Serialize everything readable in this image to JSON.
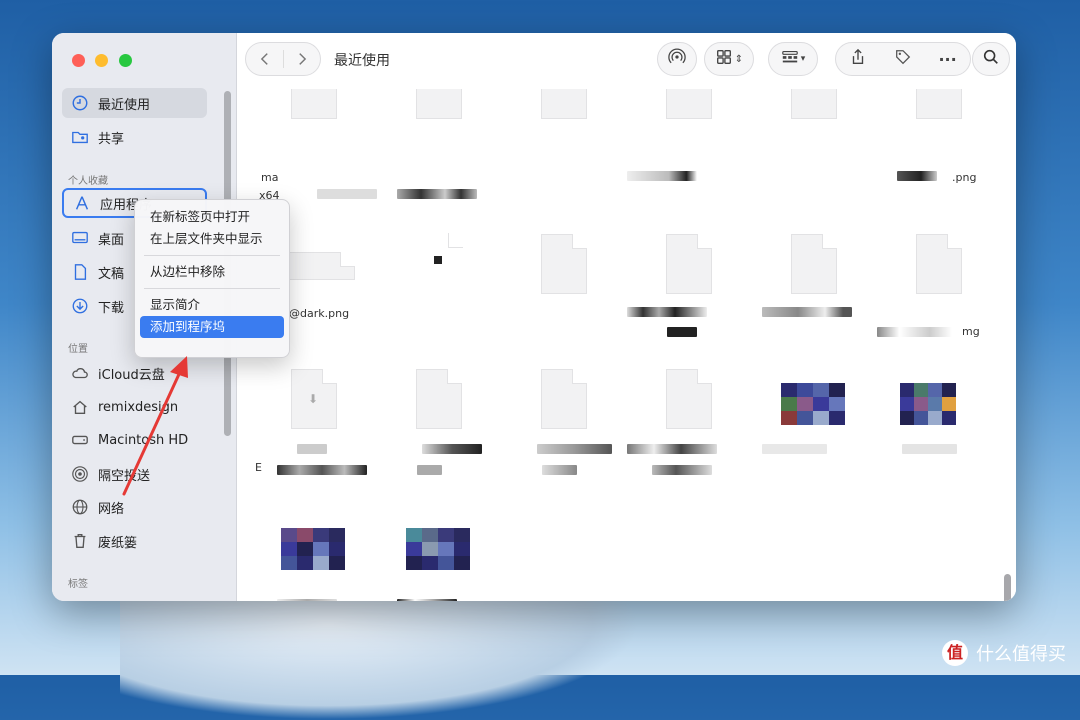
{
  "window": {
    "title": "最近使用"
  },
  "sidebar": {
    "sections": {
      "favorites": "个人收藏",
      "locations": "位置",
      "tags": "标签"
    },
    "items": [
      {
        "label": "最近使用",
        "icon": "clock-icon"
      },
      {
        "label": "共享",
        "icon": "shared-folder-icon"
      },
      {
        "label": "应用程序",
        "icon": "applications-icon"
      },
      {
        "label": "桌面",
        "icon": "desktop-icon"
      },
      {
        "label": "文稿",
        "icon": "document-icon"
      },
      {
        "label": "下载",
        "icon": "download-icon"
      },
      {
        "label": "iCloud云盘",
        "icon": "cloud-icon"
      },
      {
        "label": "remixdesign",
        "icon": "home-icon"
      },
      {
        "label": "Macintosh HD",
        "icon": "disk-icon"
      },
      {
        "label": "隔空投送",
        "icon": "airdrop-icon"
      },
      {
        "label": "网络",
        "icon": "globe-icon"
      },
      {
        "label": "废纸篓",
        "icon": "trash-icon"
      }
    ]
  },
  "context_menu": {
    "items": [
      "在新标签页中打开",
      "在上层文件夹中显示",
      "从边栏中移除",
      "显示简介",
      "添加到程序坞"
    ]
  },
  "files": {
    "labels": [
      "ma",
      "x64",
      ".png",
      "@dark.png",
      "mg",
      "E"
    ]
  },
  "colors": {
    "accent": "#3a7cf0",
    "arrow": "#e53935"
  },
  "watermark": {
    "text": "什么值得买",
    "logo": "值"
  }
}
